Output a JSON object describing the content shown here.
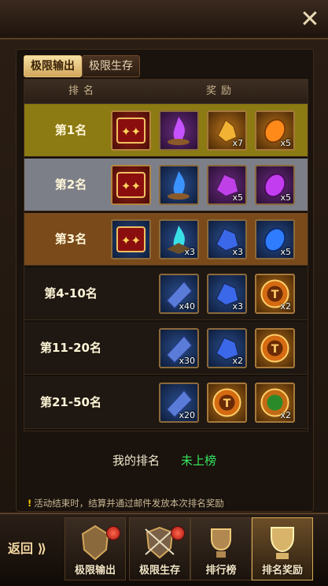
{
  "tabs": [
    "极限输出",
    "极限生存"
  ],
  "table": {
    "headers": [
      "排名",
      "奖励"
    ],
    "rows": [
      {
        "rank": "第1名",
        "items": [
          {
            "icon": "title-badge-icon",
            "style": "red",
            "count": ""
          },
          {
            "icon": "purple-flame-icon",
            "style": "purple",
            "count": ""
          },
          {
            "icon": "gold-ore-icon",
            "style": "orange",
            "count": "x7"
          },
          {
            "icon": "orange-gem-icon",
            "style": "orange",
            "count": "x5"
          }
        ]
      },
      {
        "rank": "第2名",
        "items": [
          {
            "icon": "title-badge-icon",
            "style": "red",
            "count": ""
          },
          {
            "icon": "blue-flame-icon",
            "style": "blue",
            "count": ""
          },
          {
            "icon": "purple-ore-icon",
            "style": "purple",
            "count": "x5"
          },
          {
            "icon": "purple-gem-icon",
            "style": "purple",
            "count": "x5"
          }
        ]
      },
      {
        "rank": "第3名",
        "items": [
          {
            "icon": "title-badge-icon",
            "style": "blue",
            "count": ""
          },
          {
            "icon": "cyan-flame-icon",
            "style": "blue",
            "count": "x3"
          },
          {
            "icon": "blue-ore-icon",
            "style": "blue",
            "count": "x3"
          },
          {
            "icon": "blue-gem-icon",
            "style": "blue",
            "count": "x5"
          }
        ]
      },
      {
        "rank": "第4-10名",
        "items": [
          {
            "icon": "blue-cloth-icon",
            "style": "blue",
            "count": "x40"
          },
          {
            "icon": "blue-ore-icon",
            "style": "blue",
            "count": "x3"
          },
          {
            "icon": "rune-token-icon",
            "style": "orange",
            "count": "x2"
          }
        ]
      },
      {
        "rank": "第11-20名",
        "items": [
          {
            "icon": "blue-cloth-icon",
            "style": "blue",
            "count": "x30"
          },
          {
            "icon": "blue-ore-icon",
            "style": "blue",
            "count": "x2"
          },
          {
            "icon": "rune-token-icon",
            "style": "orange",
            "count": ""
          }
        ]
      },
      {
        "rank": "第21-50名",
        "items": [
          {
            "icon": "blue-cloth-icon",
            "style": "blue",
            "count": "x20"
          },
          {
            "icon": "rune-token-icon",
            "style": "orange",
            "count": ""
          },
          {
            "icon": "green-rune-token-icon",
            "style": "orange",
            "count": "x2"
          }
        ]
      }
    ],
    "row_colors": [
      "#8c7a12",
      "#7d7f88",
      "#7a4a1a",
      "#1f1711",
      "#1f1711",
      "#1f1711"
    ]
  },
  "my_rank": {
    "label": "我的排名",
    "value": "未上榜"
  },
  "notice": "活动结束时，结算并通过邮件发放本次排名奖励",
  "back_label": "返回",
  "nav": [
    {
      "label": "极限输出",
      "icon": "warrior-helmet-icon",
      "badge": true
    },
    {
      "label": "极限生存",
      "icon": "crossed-swords-shield-icon",
      "badge": true
    },
    {
      "label": "排行榜",
      "icon": "trophy-cup-icon",
      "badge": false
    },
    {
      "label": "排名奖励",
      "icon": "reward-trophy-icon",
      "badge": false
    }
  ]
}
